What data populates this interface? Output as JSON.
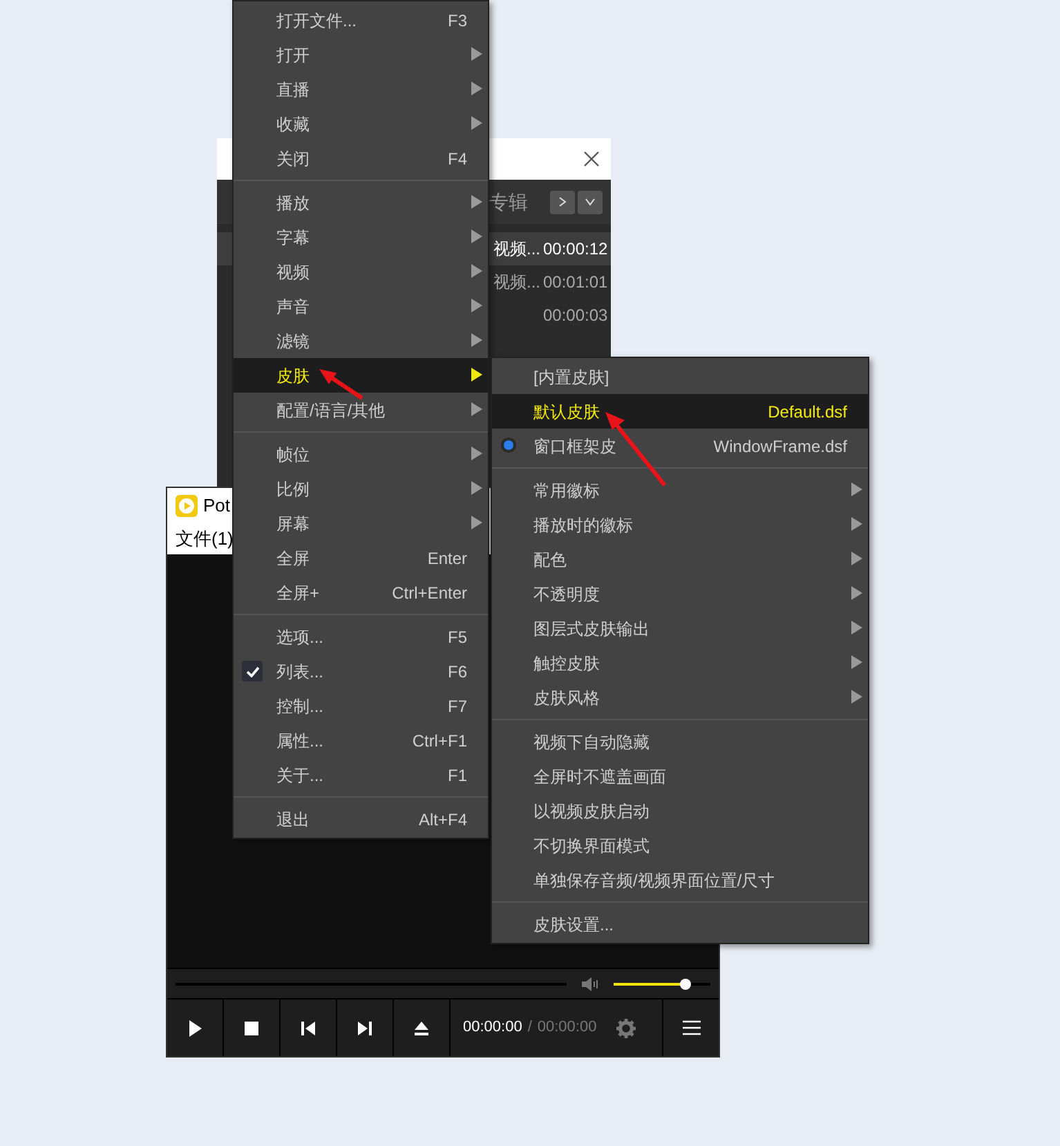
{
  "playlist_window": {
    "toolbar_text": "专辑",
    "rows": [
      {
        "title": "视频...",
        "duration": "00:00:12",
        "selected": true
      },
      {
        "title": "视频...",
        "duration": "00:01:01",
        "selected": false
      },
      {
        "duration": "00:00:03",
        "selected": false
      }
    ]
  },
  "player_window": {
    "title": "Pot",
    "menu": "文件(1)",
    "volume": {
      "level": 0.74
    },
    "current_time": "00:00:00",
    "time_separator": "/",
    "total_time": "00:00:00"
  },
  "main_menu": {
    "groups": [
      [
        {
          "label": "打开文件...",
          "shortcut": "F3",
          "submenu": false,
          "selected": false,
          "checked": false
        },
        {
          "label": "打开",
          "submenu": true,
          "selected": false,
          "checked": false
        },
        {
          "label": "直播",
          "submenu": true,
          "selected": false,
          "checked": false
        },
        {
          "label": "收藏",
          "submenu": true,
          "selected": false,
          "checked": false
        },
        {
          "label": "关闭",
          "shortcut": "F4",
          "submenu": false,
          "selected": false,
          "checked": false
        }
      ],
      [
        {
          "label": "播放",
          "submenu": true,
          "selected": false,
          "checked": false
        },
        {
          "label": "字幕",
          "submenu": true,
          "selected": false,
          "checked": false
        },
        {
          "label": "视频",
          "submenu": true,
          "selected": false,
          "checked": false
        },
        {
          "label": "声音",
          "submenu": true,
          "selected": false,
          "checked": false
        },
        {
          "label": "滤镜",
          "submenu": true,
          "selected": false,
          "checked": false
        },
        {
          "label": "皮肤",
          "submenu": true,
          "selected": true,
          "checked": false
        },
        {
          "label": "配置/语言/其他",
          "submenu": true,
          "selected": false,
          "checked": false
        }
      ],
      [
        {
          "label": "帧位",
          "submenu": true,
          "selected": false,
          "checked": false
        },
        {
          "label": "比例",
          "submenu": true,
          "selected": false,
          "checked": false
        },
        {
          "label": "屏幕",
          "submenu": true,
          "selected": false,
          "checked": false
        },
        {
          "label": "全屏",
          "shortcut": "Enter",
          "submenu": false,
          "selected": false,
          "checked": false
        },
        {
          "label": "全屏+",
          "shortcut": "Ctrl+Enter",
          "submenu": false,
          "selected": false,
          "checked": false
        }
      ],
      [
        {
          "label": "选项...",
          "shortcut": "F5",
          "submenu": false,
          "selected": false,
          "checked": false
        },
        {
          "label": "列表...",
          "shortcut": "F6",
          "submenu": false,
          "selected": false,
          "checked": true
        },
        {
          "label": "控制...",
          "shortcut": "F7",
          "submenu": false,
          "selected": false,
          "checked": false
        },
        {
          "label": "属性...",
          "shortcut": "Ctrl+F1",
          "submenu": false,
          "selected": false,
          "checked": false
        },
        {
          "label": "关于...",
          "shortcut": "F1",
          "submenu": false,
          "selected": false,
          "checked": false
        }
      ],
      [
        {
          "label": "退出",
          "shortcut": "Alt+F4",
          "submenu": false,
          "selected": false,
          "checked": false
        }
      ]
    ]
  },
  "skin_submenu": {
    "groups": [
      [
        {
          "label": "[内置皮肤]",
          "submenu": false,
          "selected": false,
          "checked": false
        },
        {
          "label": "默认皮肤",
          "shortcut": "Default.dsf",
          "submenu": false,
          "selected": true,
          "checked": false
        },
        {
          "label": "窗口框架皮",
          "shortcut": "WindowFrame.dsf",
          "submenu": false,
          "selected": false,
          "checked": true
        }
      ],
      [
        {
          "label": "常用徽标",
          "submenu": true,
          "selected": false,
          "checked": false
        },
        {
          "label": "播放时的徽标",
          "submenu": true,
          "selected": false,
          "checked": false
        },
        {
          "label": "配色",
          "submenu": true,
          "selected": false,
          "checked": false
        },
        {
          "label": "不透明度",
          "submenu": true,
          "selected": false,
          "checked": false
        },
        {
          "label": "图层式皮肤输出",
          "submenu": true,
          "selected": false,
          "checked": false
        },
        {
          "label": "触控皮肤",
          "submenu": true,
          "selected": false,
          "checked": false
        },
        {
          "label": "皮肤风格",
          "submenu": true,
          "selected": false,
          "checked": false
        }
      ],
      [
        {
          "label": "视频下自动隐藏",
          "submenu": false,
          "selected": false,
          "checked": false
        },
        {
          "label": "全屏时不遮盖画面",
          "submenu": false,
          "selected": false,
          "checked": false
        },
        {
          "label": "以视频皮肤启动",
          "submenu": false,
          "selected": false,
          "checked": false
        },
        {
          "label": "不切换界面模式",
          "submenu": false,
          "selected": false,
          "checked": false
        },
        {
          "label": "单独保存音频/视频界面位置/尺寸",
          "submenu": false,
          "selected": false,
          "checked": false
        }
      ],
      [
        {
          "label": "皮肤设置...",
          "submenu": false,
          "selected": false,
          "checked": false
        }
      ]
    ]
  }
}
